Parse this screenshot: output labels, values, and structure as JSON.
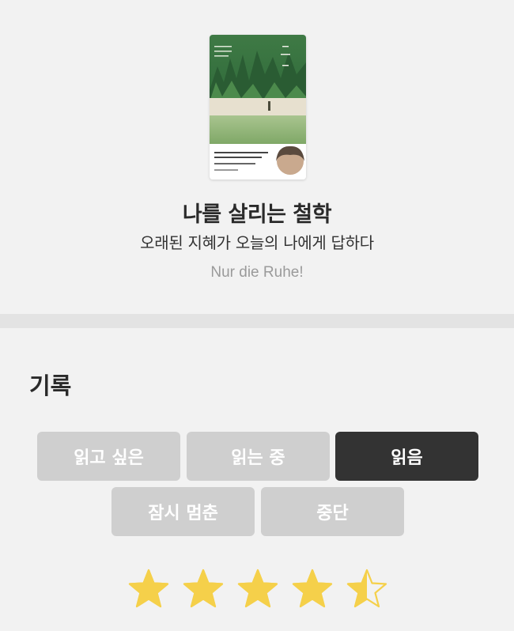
{
  "book": {
    "title": "나를 살리는 철학",
    "subtitle": "오래된 지혜가 오늘의 나에게 답하다",
    "original_title": "Nur die Ruhe!"
  },
  "record": {
    "heading": "기록",
    "statuses": [
      {
        "label": "읽고 싶은",
        "active": false
      },
      {
        "label": "읽는 중",
        "active": false
      },
      {
        "label": "읽음",
        "active": true
      },
      {
        "label": "잠시 멈춘",
        "active": false
      },
      {
        "label": "중단",
        "active": false
      }
    ]
  },
  "rating": {
    "value": 4.5,
    "max": 5
  },
  "colors": {
    "star": "#f5d04a",
    "active_button": "#333333",
    "inactive_button": "#cfcfcf"
  }
}
